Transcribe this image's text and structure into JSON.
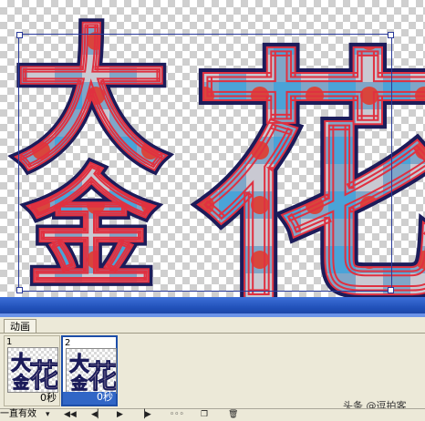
{
  "canvas": {
    "characters": [
      "大",
      "金",
      "花"
    ]
  },
  "panel": {
    "tab_label": "动画",
    "frames": [
      {
        "number": "1",
        "delay": "0秒"
      },
      {
        "number": "2",
        "delay": "0秒"
      }
    ],
    "loop_label": "一直有效"
  },
  "toolbar": {
    "buttons": [
      "first-frame-icon",
      "prev-frame-icon",
      "play-icon",
      "next-frame-icon",
      "tween-icon",
      "new-frame-icon",
      "delete-frame-icon"
    ]
  },
  "watermark": "头条 @逗拍客",
  "colors": {
    "outline_red": "#e03040",
    "fill_navy": "#1c1c5a",
    "accent_blue": "#2050b8"
  }
}
